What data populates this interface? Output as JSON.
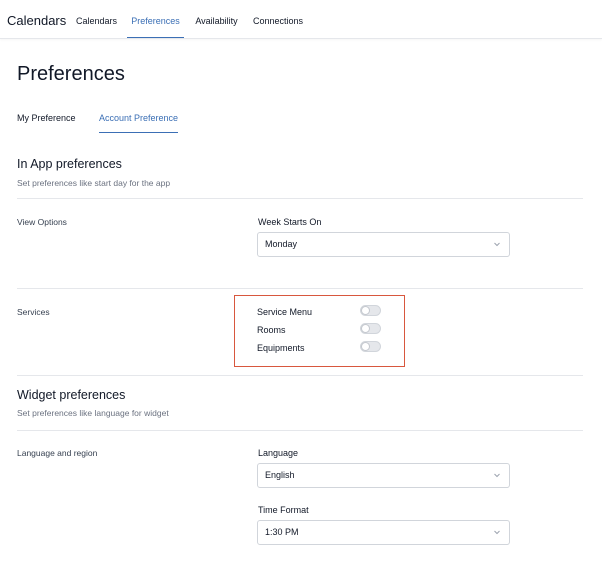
{
  "app": {
    "brand": "Calendars"
  },
  "nav": {
    "tabs": [
      {
        "label": "Calendars"
      },
      {
        "label": "Preferences",
        "active": true
      },
      {
        "label": "Availability"
      },
      {
        "label": "Connections"
      }
    ]
  },
  "page": {
    "title": "Preferences"
  },
  "subtabs": [
    {
      "label": "My Preference"
    },
    {
      "label": "Account Preference",
      "active": true
    }
  ],
  "in_app": {
    "title": "In App preferences",
    "description": "Set preferences like start day for the app",
    "view_options": {
      "label": "View Options",
      "week_starts_on": {
        "label": "Week Starts On",
        "value": "Monday"
      }
    },
    "services": {
      "label": "Services",
      "toggles": [
        {
          "label": "Service Menu",
          "on": false
        },
        {
          "label": "Rooms",
          "on": false
        },
        {
          "label": "Equipments",
          "on": false
        }
      ]
    }
  },
  "widget": {
    "title": "Widget preferences",
    "description": "Set preferences like language for widget",
    "language_region": {
      "label": "Language and region",
      "language": {
        "label": "Language",
        "value": "English"
      },
      "time_format": {
        "label": "Time Format",
        "value": "1:30 PM"
      }
    }
  },
  "colors": {
    "accent": "#3b6fb5",
    "highlight_border": "#d8573e",
    "toggle_off": "#e5e7eb"
  },
  "icons": {
    "select_arrow": "chevron-down-icon"
  }
}
